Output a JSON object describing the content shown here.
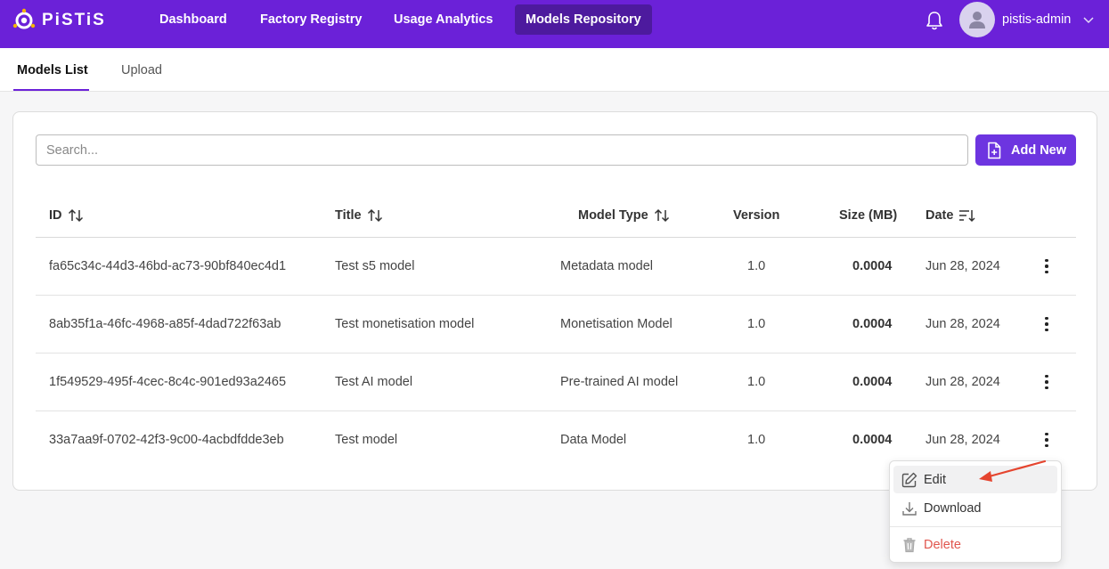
{
  "app": {
    "brand": "PiSTiS"
  },
  "nav": {
    "items": [
      {
        "label": "Dashboard"
      },
      {
        "label": "Factory Registry"
      },
      {
        "label": "Usage Analytics"
      },
      {
        "label": "Models Repository",
        "active": true
      }
    ],
    "user": {
      "name": "pistis-admin"
    }
  },
  "subtabs": [
    {
      "label": "Models List",
      "active": true
    },
    {
      "label": "Upload"
    }
  ],
  "search": {
    "placeholder": "Search...",
    "value": ""
  },
  "add_button": {
    "label": "Add New"
  },
  "table": {
    "columns": [
      "ID",
      "Title",
      "Model Type",
      "Version",
      "Size (MB)",
      "Date"
    ],
    "rows": [
      [
        "fa65c34c-44d3-46bd-ac73-90bf840ec4d1",
        "Test s5 model",
        "Metadata model",
        "1.0",
        "0.0004",
        "Jun 28, 2024"
      ],
      [
        "8ab35f1a-46fc-4968-a85f-4dad722f63ab",
        "Test monetisation model",
        "Monetisation Model",
        "1.0",
        "0.0004",
        "Jun 28, 2024"
      ],
      [
        "1f549529-495f-4cec-8c4c-901ed93a2465",
        "Test AI model",
        "Pre-trained AI model",
        "1.0",
        "0.0004",
        "Jun 28, 2024"
      ],
      [
        "33a7aa9f-0702-42f3-9c00-4acbdfdde3eb",
        "Test model",
        "Data Model",
        "1.0",
        "0.0004",
        "Jun 28, 2024"
      ]
    ]
  },
  "context_menu": {
    "items": [
      {
        "label": "Edit",
        "icon": "edit-icon"
      },
      {
        "label": "Download",
        "icon": "download-icon"
      },
      {
        "label": "Delete",
        "icon": "trash-icon"
      }
    ]
  },
  "colors": {
    "brand": "#6b21d8",
    "active_nav": "#4d1a9e",
    "button": "#6d35e0",
    "danger": "#e0554d",
    "arrow": "#e5452f"
  }
}
